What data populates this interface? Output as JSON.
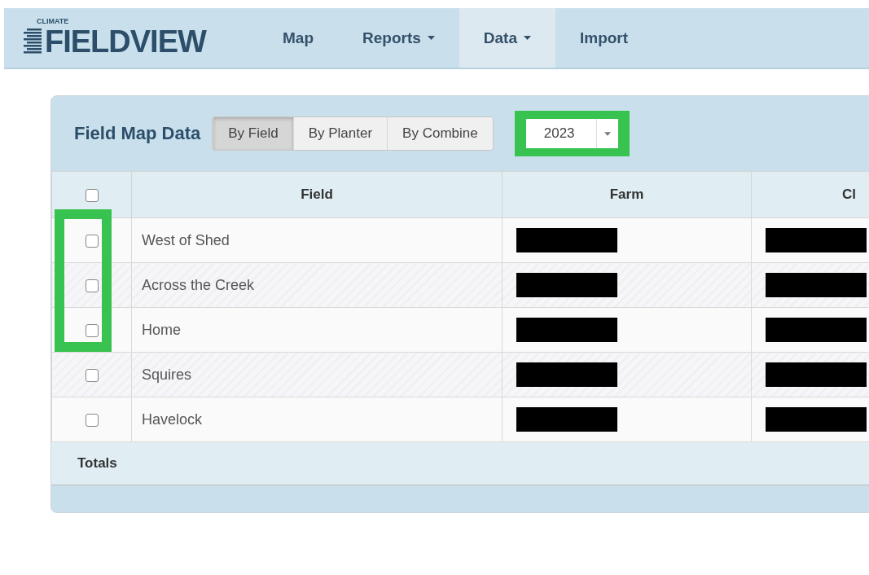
{
  "nav": {
    "logo_small": "CLIMATE",
    "logo": "FIELDVIEW",
    "items": [
      {
        "label": "Map",
        "dropdown": false,
        "selected": false
      },
      {
        "label": "Reports",
        "dropdown": true,
        "selected": false
      },
      {
        "label": "Data",
        "dropdown": true,
        "selected": true
      },
      {
        "label": "Import",
        "dropdown": false,
        "selected": false
      }
    ]
  },
  "panel": {
    "title": "Field Map Data",
    "views": [
      {
        "label": "By Field",
        "selected": true
      },
      {
        "label": "By Planter",
        "selected": false
      },
      {
        "label": "By Combine",
        "selected": false
      }
    ],
    "year": {
      "value": "2023",
      "highlighted": true
    }
  },
  "table": {
    "select_all_checked": false,
    "columns": [
      "Field",
      "Farm",
      "Cl"
    ],
    "rows": [
      {
        "field": "West of Shed",
        "checked": false,
        "redacted": true,
        "highlighted": true
      },
      {
        "field": "Across the Creek",
        "checked": false,
        "redacted": true,
        "highlighted": true
      },
      {
        "field": "Home",
        "checked": false,
        "redacted": true,
        "highlighted": true
      },
      {
        "field": "Squires",
        "checked": false,
        "redacted": true,
        "highlighted": false
      },
      {
        "field": "Havelock",
        "checked": false,
        "redacted": true,
        "highlighted": false
      }
    ],
    "totals_label": "Totals"
  }
}
